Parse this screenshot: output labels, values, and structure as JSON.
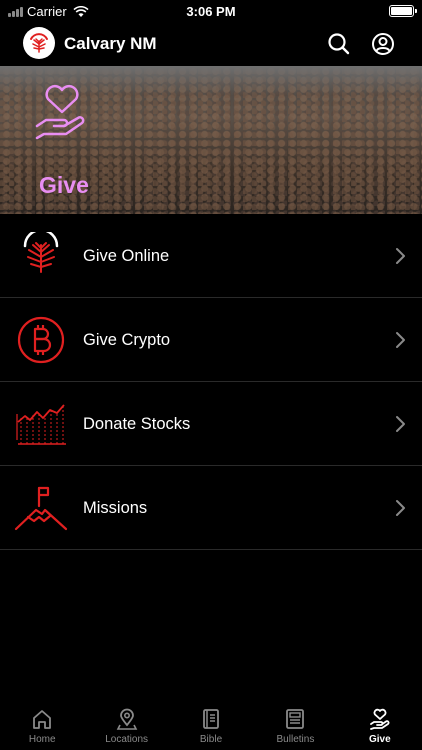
{
  "status_bar": {
    "carrier": "Carrier",
    "time": "3:06 PM"
  },
  "header": {
    "title": "Calvary NM"
  },
  "hero": {
    "title": "Give"
  },
  "menu": [
    {
      "label": "Give Online",
      "icon": "give-online-icon"
    },
    {
      "label": "Give Crypto",
      "icon": "bitcoin-icon"
    },
    {
      "label": "Donate Stocks",
      "icon": "stocks-chart-icon"
    },
    {
      "label": "Missions",
      "icon": "mountain-flag-icon"
    }
  ],
  "tabs": [
    {
      "label": "Home",
      "icon": "home-icon",
      "active": false
    },
    {
      "label": "Locations",
      "icon": "location-pin-icon",
      "active": false
    },
    {
      "label": "Bible",
      "icon": "bible-icon",
      "active": false
    },
    {
      "label": "Bulletins",
      "icon": "bulletin-icon",
      "active": false
    },
    {
      "label": "Give",
      "icon": "give-hand-icon",
      "active": true
    }
  ],
  "colors": {
    "accent": "#e02020",
    "hero_title": "#e88ef2",
    "background": "#000000"
  }
}
